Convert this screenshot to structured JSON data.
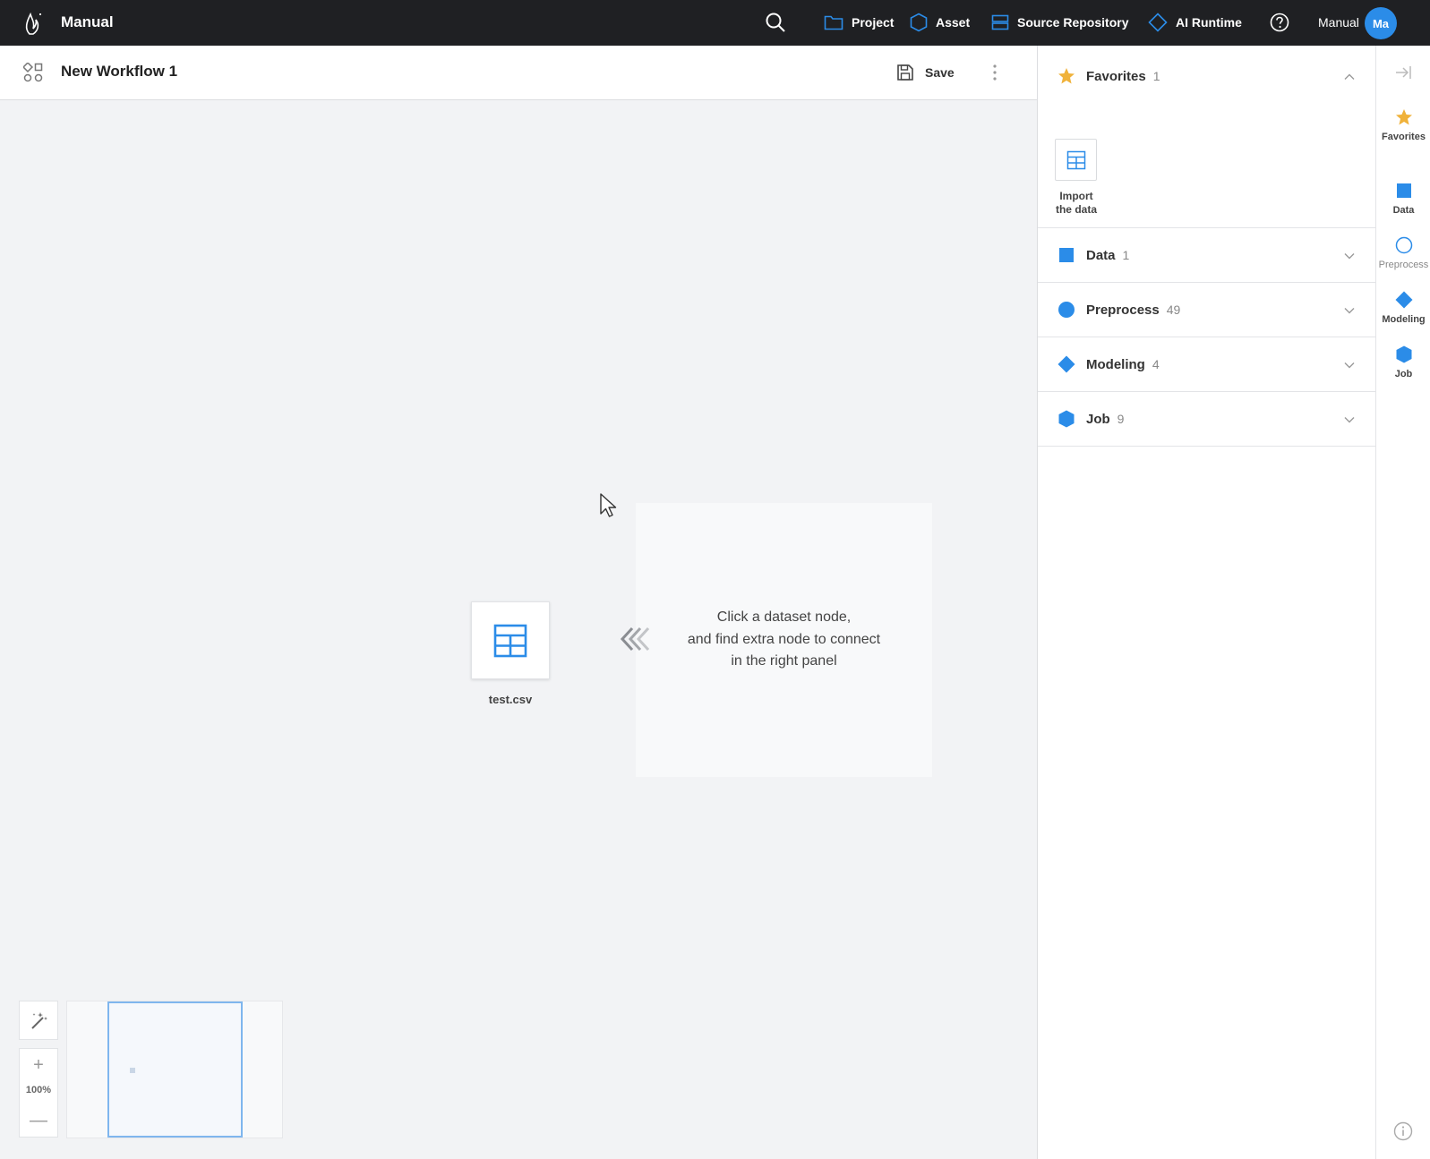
{
  "app": {
    "name": "Manual",
    "logo_icon": "flame-logo-icon"
  },
  "nav": {
    "search_icon": "search-icon",
    "items": [
      {
        "label": "Project",
        "icon": "folder-icon"
      },
      {
        "label": "Asset",
        "icon": "hexagon-icon"
      },
      {
        "label": "Source Repository",
        "icon": "repository-icon"
      },
      {
        "label": "AI Runtime",
        "icon": "diamond-icon"
      }
    ],
    "help_icon": "help-icon",
    "user": {
      "name": "Manual",
      "initials": "Ma",
      "avatar_color": "#2b8ce8"
    }
  },
  "workflow": {
    "title": "New Workflow 1",
    "save_label": "Save"
  },
  "canvas": {
    "hint_lines": [
      "Click a dataset node,",
      "and find extra node to connect",
      "in the right panel"
    ],
    "node": {
      "label": "test.csv",
      "icon": "table-icon"
    },
    "zoom_level": "100%",
    "zoom_in": "+",
    "zoom_out": "—"
  },
  "panel": {
    "categories": [
      {
        "label": "Favorites",
        "count": "1",
        "expanded": true,
        "color": "#f0b23a"
      },
      {
        "label": "Data",
        "count": "1",
        "expanded": false,
        "color": "#2b8ce8"
      },
      {
        "label": "Preprocess",
        "count": "49",
        "expanded": false,
        "color": "#2b8ce8"
      },
      {
        "label": "Modeling",
        "count": "4",
        "expanded": false,
        "color": "#2b8ce8"
      },
      {
        "label": "Job",
        "count": "9",
        "expanded": false,
        "color": "#2b8ce8"
      }
    ],
    "favorites_items": [
      {
        "label_line1": "Import",
        "label_line2": "the data",
        "icon": "table-icon"
      }
    ]
  },
  "rail": {
    "items": [
      {
        "label": "Favorites"
      },
      {
        "label": "Data"
      },
      {
        "label": "Preprocess"
      },
      {
        "label": "Modeling"
      },
      {
        "label": "Job"
      }
    ]
  },
  "colors": {
    "accent": "#2b8ce8",
    "favorite": "#f0b23a",
    "topbar": "#1f2023"
  }
}
